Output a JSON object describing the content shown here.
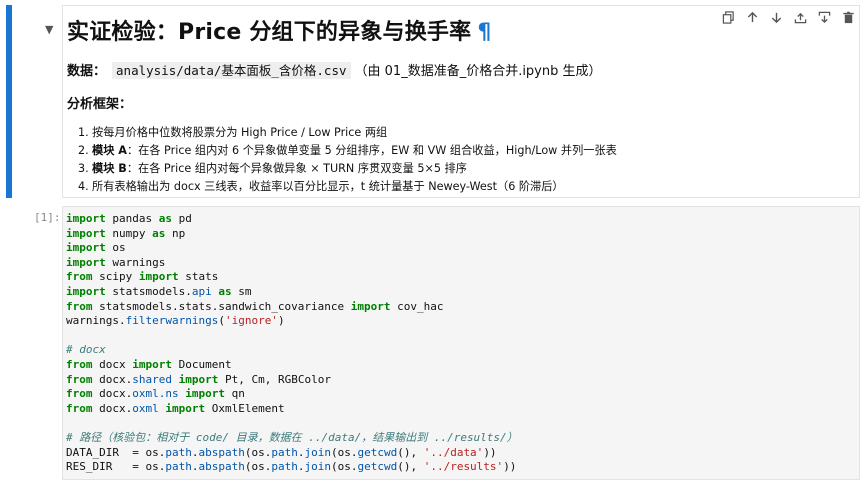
{
  "markdown_cell": {
    "title": "实证检验：Price 分组下的异象与换手率",
    "anchor": "¶",
    "data_label": "数据：",
    "data_path": "analysis/data/基本面板_含价格.csv",
    "data_note": "（由 01_数据准备_价格合并.ipynb 生成）",
    "framework_heading": "分析框架：",
    "items": [
      {
        "num": "1.",
        "bold": "",
        "text": "按每月价格中位数将股票分为 High Price / Low Price 两组"
      },
      {
        "num": "2.",
        "bold": "模块 A",
        "text": "：在各 Price 组内对 6 个异象做单变量 5 分组排序，EW 和 VW 组合收益，High/Low 并列一张表"
      },
      {
        "num": "3.",
        "bold": "模块 B",
        "text": "：在各 Price 组内对每个异象做异象 × TURN 序贯双变量 5×5 排序"
      },
      {
        "num": "4.",
        "bold": "",
        "text": "所有表格输出为 docx 三线表，收益率以百分比显示，t 统计量基于 Newey-West（6 阶滞后）"
      }
    ]
  },
  "toolbar": {
    "icons": [
      "copy-icon",
      "move-up-icon",
      "move-down-icon",
      "insert-above-icon",
      "insert-below-icon",
      "delete-icon"
    ]
  },
  "code_cell": {
    "prompt": "[1]:",
    "lines": [
      [
        [
          "kw",
          "import"
        ],
        [
          "t",
          " pandas "
        ],
        [
          "kw",
          "as"
        ],
        [
          "t",
          " pd"
        ]
      ],
      [
        [
          "kw",
          "import"
        ],
        [
          "t",
          " numpy "
        ],
        [
          "kw",
          "as"
        ],
        [
          "t",
          " np"
        ]
      ],
      [
        [
          "kw",
          "import"
        ],
        [
          "t",
          " os"
        ]
      ],
      [
        [
          "kw",
          "import"
        ],
        [
          "t",
          " warnings"
        ]
      ],
      [
        [
          "kw",
          "from"
        ],
        [
          "t",
          " scipy "
        ],
        [
          "kw",
          "import"
        ],
        [
          "t",
          " stats"
        ]
      ],
      [
        [
          "kw",
          "import"
        ],
        [
          "t",
          " statsmodels."
        ],
        [
          "mod",
          "api"
        ],
        [
          "t",
          " "
        ],
        [
          "kw",
          "as"
        ],
        [
          "t",
          " sm"
        ]
      ],
      [
        [
          "kw",
          "from"
        ],
        [
          "t",
          " statsmodels.stats.sandwich_covariance "
        ],
        [
          "kw",
          "import"
        ],
        [
          "t",
          " cov_hac"
        ]
      ],
      [
        [
          "t",
          "warnings."
        ],
        [
          "mod",
          "filterwarnings"
        ],
        [
          "t",
          "("
        ],
        [
          "str",
          "'ignore'"
        ],
        [
          "t",
          ")"
        ]
      ],
      [
        [
          "t",
          ""
        ]
      ],
      [
        [
          "cm",
          "# docx"
        ]
      ],
      [
        [
          "kw",
          "from"
        ],
        [
          "t",
          " docx "
        ],
        [
          "kw",
          "import"
        ],
        [
          "t",
          " Document"
        ]
      ],
      [
        [
          "kw",
          "from"
        ],
        [
          "t",
          " docx."
        ],
        [
          "mod",
          "shared"
        ],
        [
          "t",
          " "
        ],
        [
          "kw",
          "import"
        ],
        [
          "t",
          " Pt, Cm, RGBColor"
        ]
      ],
      [
        [
          "kw",
          "from"
        ],
        [
          "t",
          " docx."
        ],
        [
          "mod",
          "oxml.ns"
        ],
        [
          "t",
          " "
        ],
        [
          "kw",
          "import"
        ],
        [
          "t",
          " qn"
        ]
      ],
      [
        [
          "kw",
          "from"
        ],
        [
          "t",
          " docx."
        ],
        [
          "mod",
          "oxml"
        ],
        [
          "t",
          " "
        ],
        [
          "kw",
          "import"
        ],
        [
          "t",
          " OxmlElement"
        ]
      ],
      [
        [
          "t",
          ""
        ]
      ],
      [
        [
          "cm",
          "# 路径（核验包：相对于 code/ 目录，数据在 ../data/，结果输出到 ../results/）"
        ]
      ],
      [
        [
          "t",
          "DATA_DIR  = os."
        ],
        [
          "mod",
          "path"
        ],
        [
          "t",
          "."
        ],
        [
          "mod",
          "abspath"
        ],
        [
          "t",
          "(os."
        ],
        [
          "mod",
          "path"
        ],
        [
          "t",
          "."
        ],
        [
          "mod",
          "join"
        ],
        [
          "t",
          "(os."
        ],
        [
          "mod",
          "getcwd"
        ],
        [
          "t",
          "(), "
        ],
        [
          "str",
          "'../data'"
        ],
        [
          "t",
          "))"
        ]
      ],
      [
        [
          "t",
          "RES_DIR   = os."
        ],
        [
          "mod",
          "path"
        ],
        [
          "t",
          "."
        ],
        [
          "mod",
          "abspath"
        ],
        [
          "t",
          "(os."
        ],
        [
          "mod",
          "path"
        ],
        [
          "t",
          "."
        ],
        [
          "mod",
          "join"
        ],
        [
          "t",
          "(os."
        ],
        [
          "mod",
          "getcwd"
        ],
        [
          "t",
          "(), "
        ],
        [
          "str",
          "'../results'"
        ],
        [
          "t",
          "))"
        ]
      ]
    ]
  },
  "colors": {
    "active_bar": "#1976d2",
    "keyword": "#008000",
    "string": "#ba2121",
    "comment": "#3d7b7b",
    "module": "#0055aa"
  }
}
